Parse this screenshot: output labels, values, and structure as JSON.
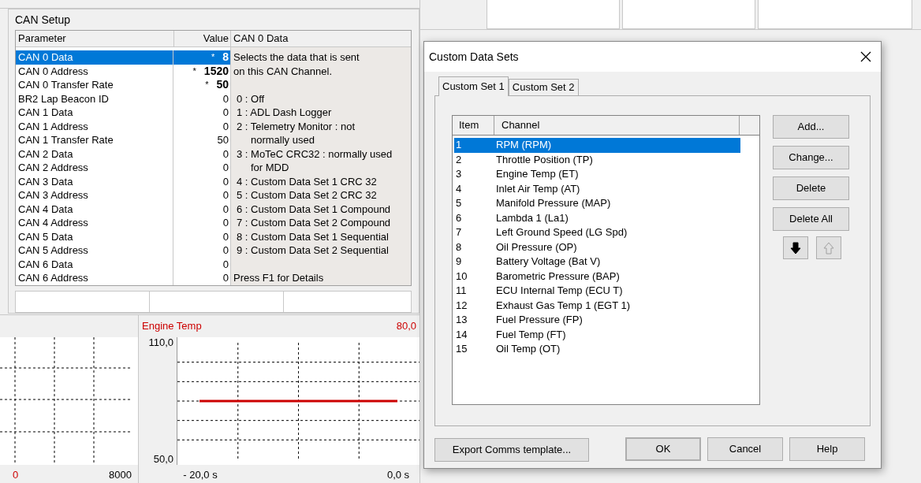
{
  "can_setup": {
    "title": "CAN Setup",
    "columns": [
      "Parameter",
      "Value",
      "CAN 0 Data"
    ],
    "rows": [
      {
        "name": "CAN 0 Data",
        "value": "8",
        "marker": "*",
        "modified": true,
        "selected": true
      },
      {
        "name": "CAN 0 Address",
        "value": "1520",
        "marker": "*",
        "modified": true,
        "selected": false
      },
      {
        "name": "CAN 0 Transfer Rate",
        "value": "50",
        "marker": "*",
        "modified": true,
        "selected": false
      },
      {
        "name": "BR2 Lap Beacon ID",
        "value": "0",
        "modified": false,
        "selected": false
      },
      {
        "name": "CAN 1 Data",
        "value": "0",
        "modified": false,
        "selected": false
      },
      {
        "name": "CAN 1 Address",
        "value": "0",
        "modified": false,
        "selected": false
      },
      {
        "name": "CAN 1 Transfer Rate",
        "value": "50",
        "modified": false,
        "selected": false
      },
      {
        "name": "CAN 2 Data",
        "value": "0",
        "modified": false,
        "selected": false
      },
      {
        "name": "CAN 2 Address",
        "value": "0",
        "modified": false,
        "selected": false
      },
      {
        "name": "CAN 3 Data",
        "value": "0",
        "modified": false,
        "selected": false
      },
      {
        "name": "CAN 3 Address",
        "value": "0",
        "modified": false,
        "selected": false
      },
      {
        "name": "CAN 4 Data",
        "value": "0",
        "modified": false,
        "selected": false
      },
      {
        "name": "CAN 4 Address",
        "value": "0",
        "modified": false,
        "selected": false
      },
      {
        "name": "CAN 5 Data",
        "value": "0",
        "modified": false,
        "selected": false
      },
      {
        "name": "CAN 5 Address",
        "value": "0",
        "modified": false,
        "selected": false
      },
      {
        "name": "CAN 6 Data",
        "value": "0",
        "modified": false,
        "selected": false
      },
      {
        "name": "CAN 6 Address",
        "value": "0",
        "modified": false,
        "selected": false
      }
    ],
    "description": {
      "intro": [
        "Selects the data that is sent",
        "on this CAN Channel."
      ],
      "options": [
        {
          "text": "0 : Off"
        },
        {
          "text": "1 : ADL Dash Logger"
        },
        {
          "text": "2 : Telemetry Monitor : not",
          "continuation": "normally used"
        },
        {
          "text": "3 : MoTeC CRC32 : normally used",
          "continuation": "for MDD"
        },
        {
          "text": "4 : Custom Data Set 1 CRC 32"
        },
        {
          "text": "5 : Custom Data Set 2 CRC 32"
        },
        {
          "text": "6 : Custom Data Set 1 Compound"
        },
        {
          "text": "7 : Custom Data Set 2 Compound"
        },
        {
          "text": "8 : Custom Data Set 1 Sequential"
        },
        {
          "text": "9 : Custom Data Set 2 Sequential"
        }
      ],
      "footer": "Press F1 for Details"
    }
  },
  "rpm_graph": {
    "axis_min": "0",
    "axis_max": "8000"
  },
  "engine_temp_graph": {
    "reading": "80,0",
    "chart_data": {
      "type": "line",
      "x": [
        -20,
        0
      ],
      "xlim": [
        -20,
        0
      ],
      "ylim": [
        50,
        110
      ],
      "xticks": [
        {
          "value": -20,
          "label": "- 20,0 s"
        },
        {
          "value": 0,
          "label": "0,0 s"
        }
      ],
      "yticks": [
        {
          "value": 110,
          "label": "110,0"
        },
        {
          "value": 50,
          "label": "50,0"
        }
      ],
      "series": [
        {
          "name": "Engine Temp",
          "color": "#cc0000",
          "values": [
            80,
            80
          ]
        }
      ]
    }
  },
  "dialog": {
    "title": "Custom Data Sets",
    "tabs": [
      {
        "label": "Custom Set 1",
        "selected": true
      },
      {
        "label": "Custom Set 2",
        "selected": false
      }
    ],
    "list": {
      "columns": [
        "Item",
        "Channel"
      ],
      "rows": [
        {
          "item": "1",
          "channel": "RPM (RPM)",
          "selected": true
        },
        {
          "item": "2",
          "channel": "Throttle Position (TP)",
          "selected": false
        },
        {
          "item": "3",
          "channel": "Engine Temp (ET)",
          "selected": false
        },
        {
          "item": "4",
          "channel": "Inlet Air Temp (AT)",
          "selected": false
        },
        {
          "item": "5",
          "channel": "Manifold Pressure (MAP)",
          "selected": false
        },
        {
          "item": "6",
          "channel": "Lambda 1 (La1)",
          "selected": false
        },
        {
          "item": "7",
          "channel": "Left Ground Speed (LG Spd)",
          "selected": false
        },
        {
          "item": "8",
          "channel": "Oil Pressure (OP)",
          "selected": false
        },
        {
          "item": "9",
          "channel": "Battery Voltage (Bat V)",
          "selected": false
        },
        {
          "item": "10",
          "channel": "Barometric Pressure (BAP)",
          "selected": false
        },
        {
          "item": "11",
          "channel": "ECU Internal Temp (ECU T)",
          "selected": false
        },
        {
          "item": "12",
          "channel": "Exhaust Gas Temp 1 (EGT 1)",
          "selected": false
        },
        {
          "item": "13",
          "channel": "Fuel Pressure (FP)",
          "selected": false
        },
        {
          "item": "14",
          "channel": "Fuel Temp (FT)",
          "selected": false
        },
        {
          "item": "15",
          "channel": "Oil Temp (OT)",
          "selected": false
        }
      ]
    },
    "side_buttons": [
      "Add...",
      "Change...",
      "Delete",
      "Delete All"
    ],
    "move_buttons": [
      {
        "kind": "down",
        "disabled": false
      },
      {
        "kind": "up",
        "disabled": true
      }
    ],
    "export_button": "Export Comms template...",
    "buttons": [
      "OK",
      "Cancel",
      "Help"
    ]
  }
}
